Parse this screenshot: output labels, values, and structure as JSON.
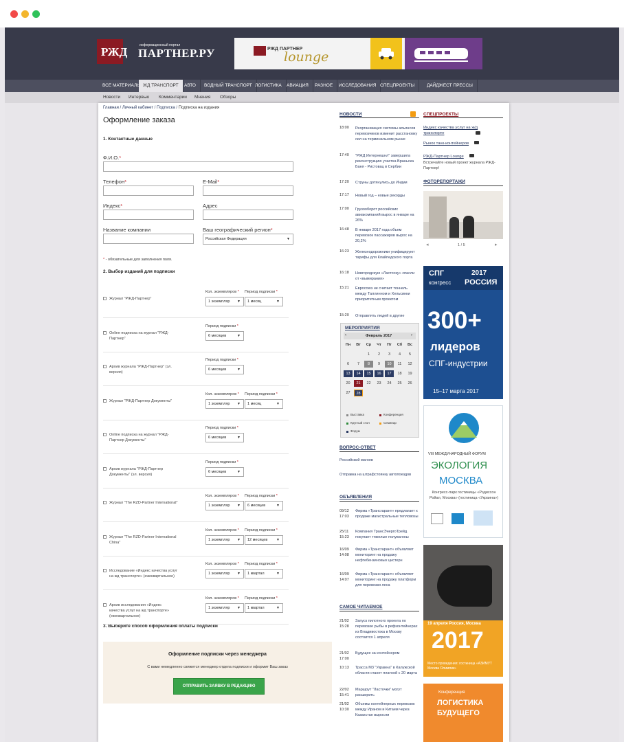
{
  "header": {
    "logo_text1": "РЖД",
    "logo_text2": "информационный портал",
    "logo_text3": "ПАРТНЕР.РУ",
    "banner_brand": "РЖД ПАРТНЕР",
    "banner_script": "lounge"
  },
  "nav": {
    "main": [
      "ВСЕ МАТЕРИАЛЫ",
      "ЖД ТРАНСПОРТ",
      "АВТО",
      "ВОДНЫЙ ТРАНСПОРТ",
      "ЛОГИСТИКА",
      "АВИАЦИЯ",
      "РАЗНОЕ",
      "ИССЛЕДОВАНИЯ",
      "СПЕЦПРОЕКТЫ",
      "ДАЙДЖЕСТ ПРЕССЫ"
    ],
    "sub": [
      "Новости",
      "Интервью",
      "Комментарии",
      "Мнения",
      "Обзоры"
    ]
  },
  "breadcrumb": {
    "home": "Главная",
    "sep1": "/",
    "cabinet": "Личный кабинет",
    "sep2": "/",
    "subscription": "Подписка",
    "sep3": "/",
    "current": "Подписка на издания"
  },
  "page_title": "Оформление заказа",
  "contact": {
    "section": "1. Контактные данные",
    "fio": "Ф.И.О.",
    "phone": "Телефон",
    "email": "E-Mail",
    "index": "Индекс",
    "address": "Адрес",
    "company": "Название компании",
    "region": "Ваш географический регион",
    "region_value": "Российская Федерация",
    "required_note": "- обязательные для заполнения поля."
  },
  "subscriptions": {
    "section": "2. Выбор изданий для подписки",
    "qty_label": "Кол. экземпляров",
    "period_label": "Период подписки",
    "star": "*",
    "items": [
      {
        "name": "Журнал \"РЖД-Партнер\"",
        "qty": "1 экземпляр",
        "period": "1 месяц"
      },
      {
        "name": "Online подписка на журнал \"РЖД-Партнер\"",
        "period": "6 месяцев"
      },
      {
        "name": "Архив журнала \"РЖД-Партнер\" (эл. версия)",
        "period": "6 месяцев"
      },
      {
        "name": "Журнал \"РЖД-Партнер Документы\"",
        "qty": "1 экземпляр",
        "period": "1 месяц"
      },
      {
        "name": "Online подписка на журнал \"РЖД-Партнер Документы\"",
        "period": "6 месяцев"
      },
      {
        "name": "Архив журнала \"РЖД-Партнер Документы\" (эл. версия)",
        "period": "6 месяцев"
      },
      {
        "name": "Журнал \"The RZD-Partner International\"",
        "qty": "1 экземпляр",
        "period": "6 месяцев"
      },
      {
        "name": "Журнал \"The RZD-Partner International China\"",
        "qty": "1 экземпляр",
        "period": "12 месяцев"
      },
      {
        "name": "Исследование «Индекс качества услуг на жд транспорте» (ежеквартальное)",
        "qty": "1 экземпляр",
        "period": "1 квартал"
      },
      {
        "name": "Архив исследования «Индекс качества услуг на жд транспорте» (ежеквартальное)",
        "qty": "1 экземпляр",
        "period": "1 квартал"
      }
    ]
  },
  "payment": {
    "section": "3. Выберите способ оформления оплаты подписки",
    "title": "Оформление подписки через менеджера",
    "desc": "С вами немедленно свяжется менеджер отдела подписки и оформит Ваш заказ",
    "button": "ОТПРАВИТЬ ЗАЯВКУ В РЕДАКЦИЮ"
  },
  "news": {
    "title": "НОВОСТИ",
    "items": [
      {
        "time": "18:00",
        "text": "Реорганизация системы альянсов перевозчиков изменит расстановку сил на терминальном рынке"
      },
      {
        "time": "17:40",
        "text": "\"РЖД Интернешнл\" завершила реконструкцию участка Враньска Баня - Ристовац в Сербии"
      },
      {
        "time": "17:20",
        "text": "Струны дотянулись до Индии"
      },
      {
        "time": "17:17",
        "text": "Новый год – новые рекорды"
      },
      {
        "time": "17:00",
        "text": "Грузооборот российских авиакомпаний вырос в январе на 26%"
      },
      {
        "time": "16:48",
        "text": "В январе 2017 года объем перевозок пассажиров вырос на 20,2%"
      },
      {
        "time": "16:23",
        "text": "Железнодорожники унифицируют тарифы для Клайпедского порта"
      },
      {
        "time": "16:18",
        "text": "Новгородскую «Ласточку» спасли от «вымирания»"
      },
      {
        "time": "15:21",
        "text": "Евросоюз не считает тоннель между Таллинном и Хельсинки приоритетным проектом"
      },
      {
        "time": "15:20",
        "text": "Отправлять людей в другие"
      }
    ]
  },
  "events": {
    "title": "МЕРОПРИЯТИЯ",
    "month": "Февраль 2017",
    "prev": "‹",
    "next": "›",
    "weekdays": [
      "Пн",
      "Вт",
      "Ср",
      "Чт",
      "Пт",
      "Сб",
      "Вс"
    ],
    "days": [
      "",
      "",
      "1",
      "2",
      "3",
      "4",
      "5",
      "6",
      "7",
      "8",
      "9",
      "10",
      "11",
      "12",
      "13",
      "14",
      "15",
      "16",
      "17",
      "18",
      "19",
      "20",
      "21",
      "22",
      "23",
      "24",
      "25",
      "26",
      "27",
      "28"
    ],
    "legend": [
      "Выставка",
      "Конференция",
      "Круглый стол",
      "Семинар",
      "Форум"
    ],
    "legend_colors": [
      "#888888",
      "#8b1a23",
      "#2e8b3a",
      "#f39c12",
      "#2b3b63"
    ]
  },
  "qa": {
    "title": "ВОПРОС-ОТВЕТ",
    "items": [
      "Российский магнев",
      "Отправка на штрафстоянку автопоездов"
    ]
  },
  "ads": {
    "title": "ОБЪЯВЛЕНИЯ",
    "items": [
      {
        "date": "09/12\n17:03",
        "text": "Фирма «Трансгарант» предлагает к продаже магистральные тепловозы"
      },
      {
        "date": "25/11\n15:23",
        "text": "Компания ТрансЭнергоТрейд покупает тяжелые полувагоны"
      },
      {
        "date": "16/09\n14:08",
        "text": "Фирма «Трансгарант» объявляет мониторинг на продажу нефтебензиновых цистерн"
      },
      {
        "date": "16/09\n14:07",
        "text": "Фирма «Трансгарант» объявляет мониторинг на продажу платформ для перевозки леса"
      }
    ]
  },
  "most_read": {
    "title": "САМОЕ ЧИТАЕМОЕ",
    "items": [
      {
        "date": "21/02\n15:28",
        "text": "Запуск пилотного проекта по перевозке рыбы в рефконтейнерах из Владивостока в Москву состоится 1 апреля"
      },
      {
        "date": "21/02\n17:00",
        "text": "Будущее за контейнером"
      },
      {
        "date": "10:13",
        "text": "Трасса М3 \"Украина\" в Калужской области станет платной с 20 марта"
      },
      {
        "date": "22/02\n15:41",
        "text": "Маршрут \"Ласточки\" могут расширить"
      },
      {
        "date": "21/02\n10:30",
        "text": "Объемы контейнерных перевозок между Ираном и Китаем через Казахстан выросли"
      }
    ]
  },
  "special": {
    "title": "СПЕЦПРОЕКТЫ",
    "items": [
      "Индекс качества услуг на ж/д транспорте",
      "Рынок танк-контейнеров",
      "РЖД-Партнер Lounge"
    ],
    "lounge_desc": "Встречайте новый проект журнала РЖД-Партнер!"
  },
  "photo": {
    "title": "ФОТОРЕПОРТАЖИ",
    "counter": "1 / 5"
  },
  "ad_lng": {
    "year": "2017",
    "top": "СПГ",
    "kongress": "конгресс",
    "russia": "РОССИЯ",
    "big": "300+",
    "leaders": "лидеров",
    "industry": "СПГ-индустрии",
    "dates": "15–17 марта 2017"
  },
  "ad_eco": {
    "forum": "VIII МЕЖДУНАРОДНЫЙ ФОРУМ",
    "eco": "ЭКОЛОГИЯ",
    "city": "МОСКВА",
    "venue": "Конгресс-парк гостиницы «Рэдиссон Ройал, Москва» (гостиница «Украина»)"
  },
  "ad_rail": {
    "date": "19 апреля Россия, Москва",
    "year": "2017",
    "place": "Место проведения: гостиница «АЗИМУТ Москва Олимпик»"
  },
  "ad_log": {
    "small": "Конференция",
    "l1": "ЛОГИСТИКА",
    "l2": "БУДУЩЕГО"
  }
}
